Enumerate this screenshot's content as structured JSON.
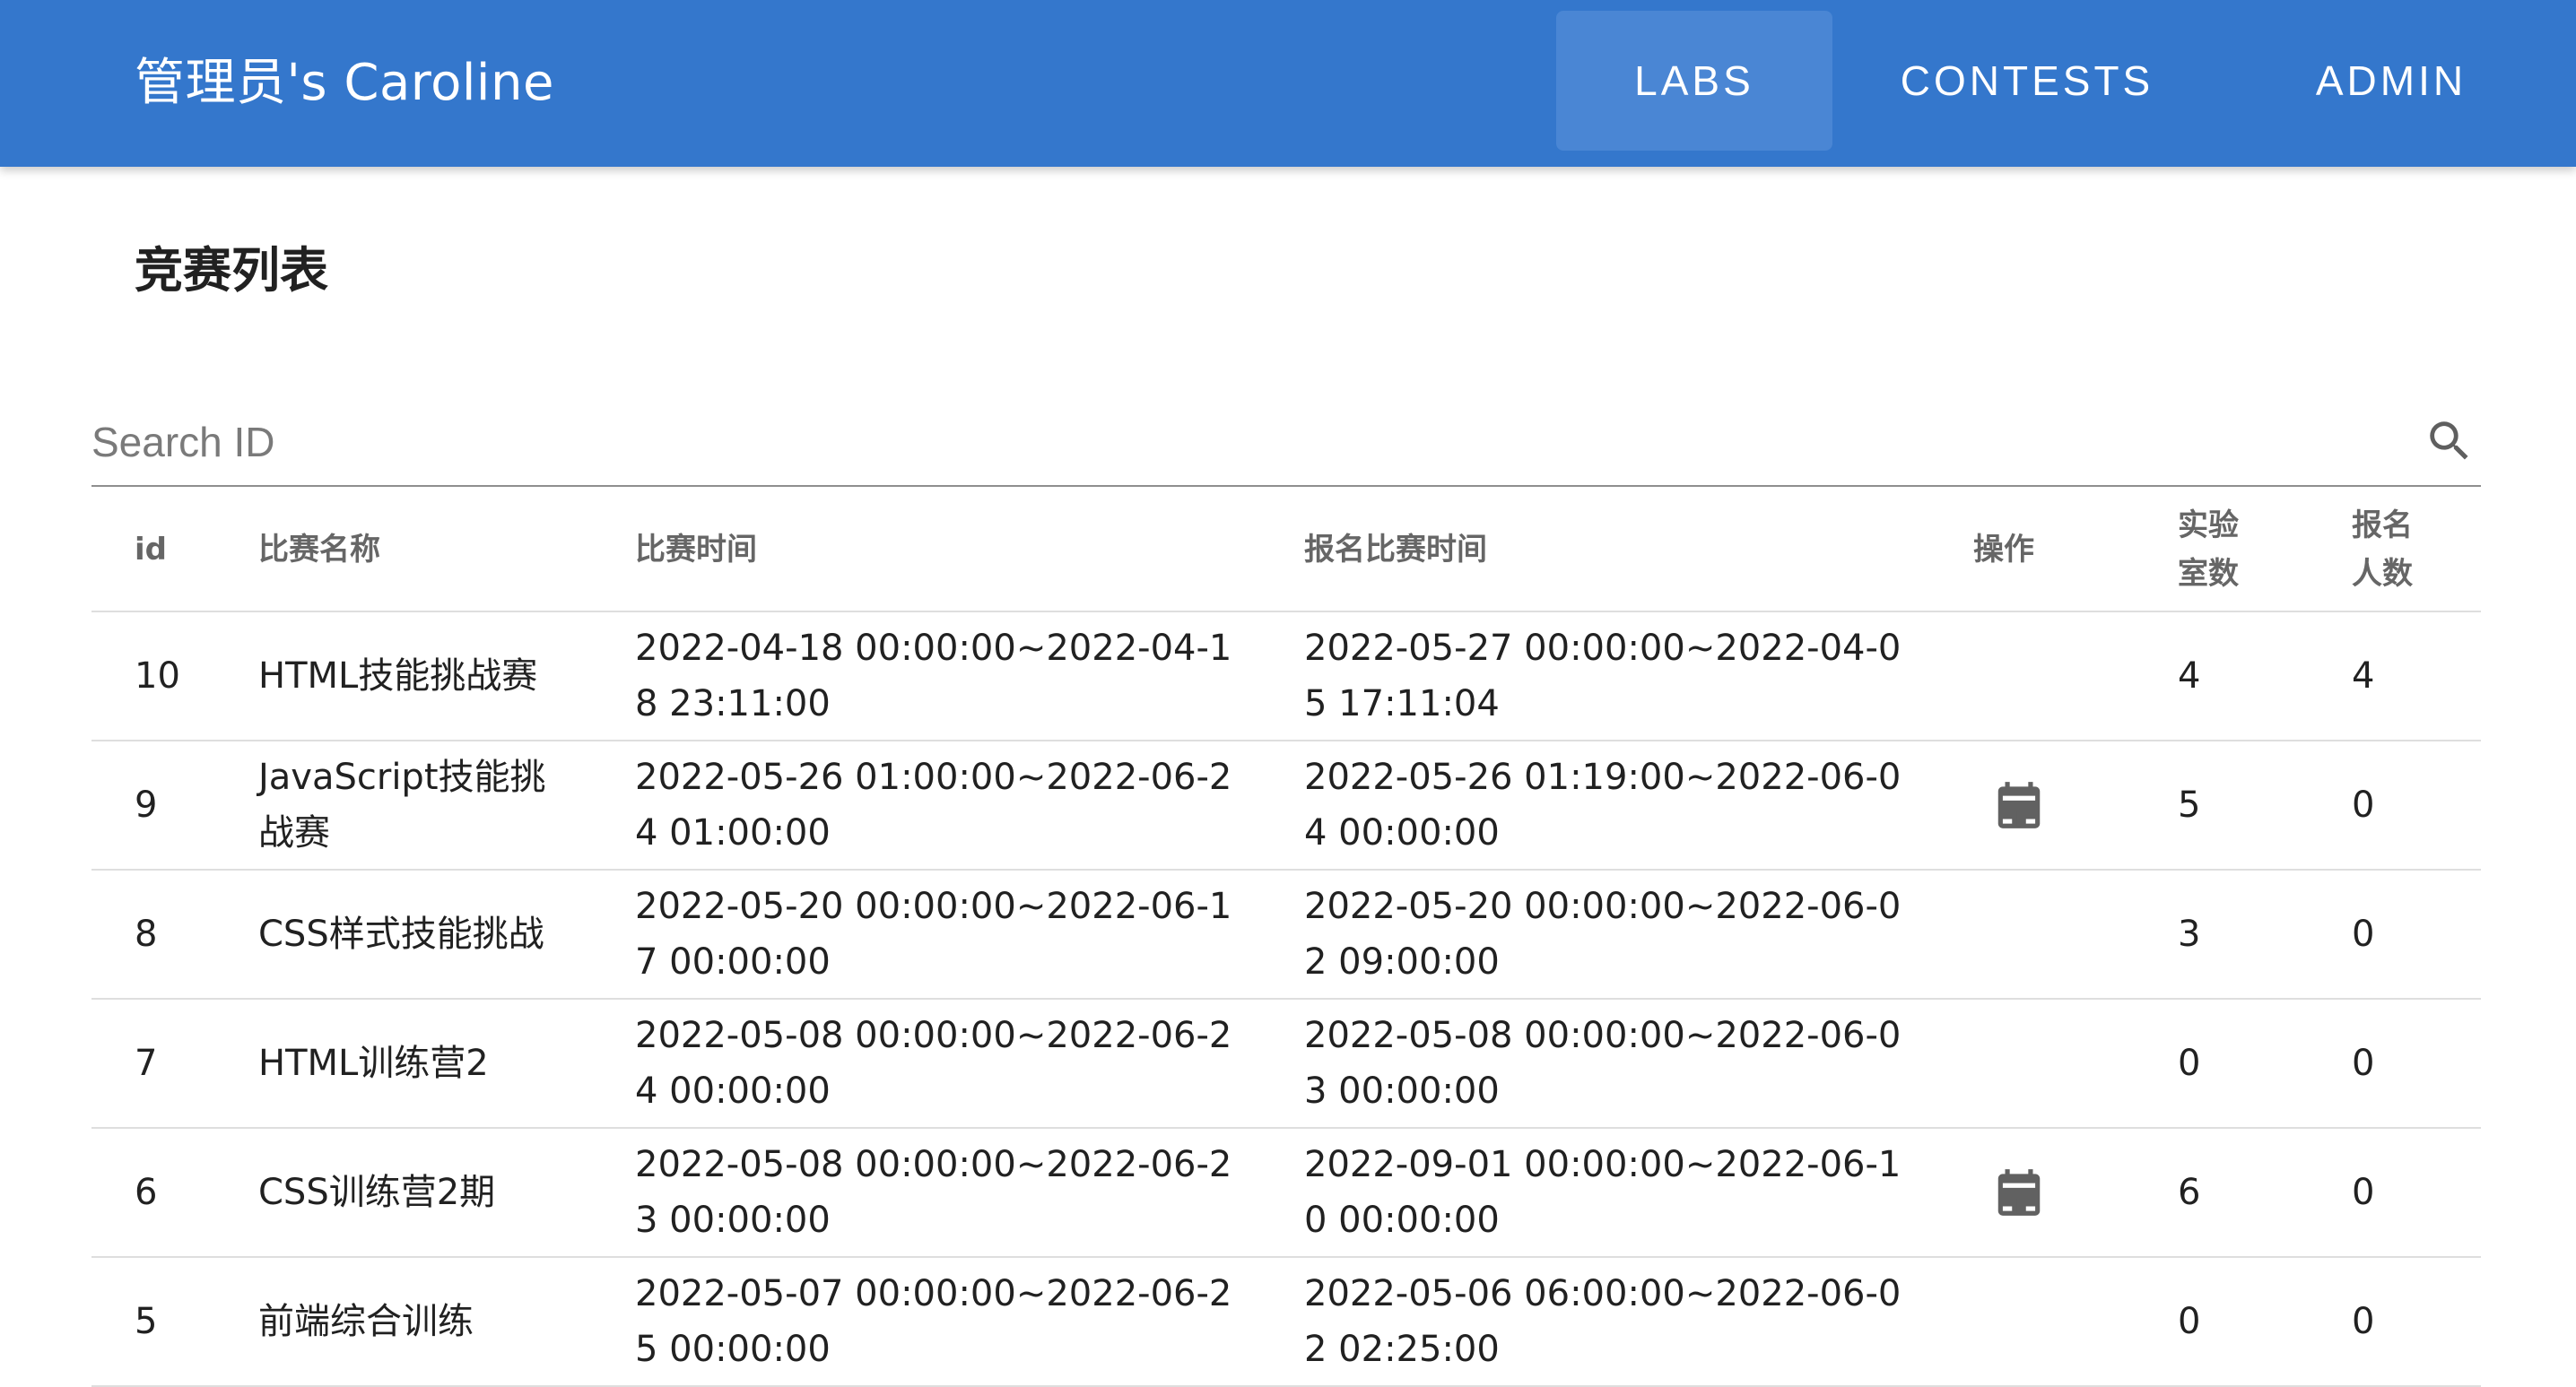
{
  "appbar": {
    "brand": "管理员's Caroline",
    "nav": [
      {
        "label": "LABS"
      },
      {
        "label": "CONTESTS"
      },
      {
        "label": "ADMIN"
      }
    ]
  },
  "page": {
    "title": "竞赛列表"
  },
  "search": {
    "placeholder": "Search ID",
    "value": ""
  },
  "table": {
    "columns": {
      "id": "id",
      "name": "比赛名称",
      "time": "比赛时间",
      "reg_time": "报名比赛时间",
      "op": "操作",
      "labs": "实验室数",
      "people": "报名人数"
    },
    "rows": [
      {
        "id": "10",
        "name": "HTML技能挑战赛",
        "time": "2022-04-18 00:00:00~2022-04-18 23:11:00",
        "reg_time": "2022-05-27 00:00:00~2022-04-05 17:11:04",
        "op_icon": "",
        "labs": "4",
        "people": "4"
      },
      {
        "id": "9",
        "name": "JavaScript技能挑战赛",
        "time": "2022-05-26 01:00:00~2022-06-24 01:00:00",
        "reg_time": "2022-05-26 01:19:00~2022-06-04 00:00:00",
        "op_icon": "calendar-publish-icon",
        "labs": "5",
        "people": "0"
      },
      {
        "id": "8",
        "name": "CSS样式技能挑战",
        "time": "2022-05-20 00:00:00~2022-06-17 00:00:00",
        "reg_time": "2022-05-20 00:00:00~2022-06-02 09:00:00",
        "op_icon": "",
        "labs": "3",
        "people": "0"
      },
      {
        "id": "7",
        "name": "HTML训练营2",
        "time": "2022-05-08 00:00:00~2022-06-24 00:00:00",
        "reg_time": "2022-05-08 00:00:00~2022-06-03 00:00:00",
        "op_icon": "",
        "labs": "0",
        "people": "0"
      },
      {
        "id": "6",
        "name": "CSS训练营2期",
        "time": "2022-05-08 00:00:00~2022-06-23 00:00:00",
        "reg_time": "2022-09-01 00:00:00~2022-06-10 00:00:00",
        "op_icon": "calendar-publish-icon",
        "labs": "6",
        "people": "0"
      },
      {
        "id": "5",
        "name": "前端综合训练",
        "time": "2022-05-07 00:00:00~2022-06-25 00:00:00",
        "reg_time": "2022-05-06 06:00:00~2022-06-02 02:25:00",
        "op_icon": "",
        "labs": "0",
        "people": "0"
      }
    ]
  },
  "colors": {
    "appbar": "#3477cc",
    "nav_active": "#4a86d4",
    "header_text": "#666666",
    "icon": "#616161"
  }
}
